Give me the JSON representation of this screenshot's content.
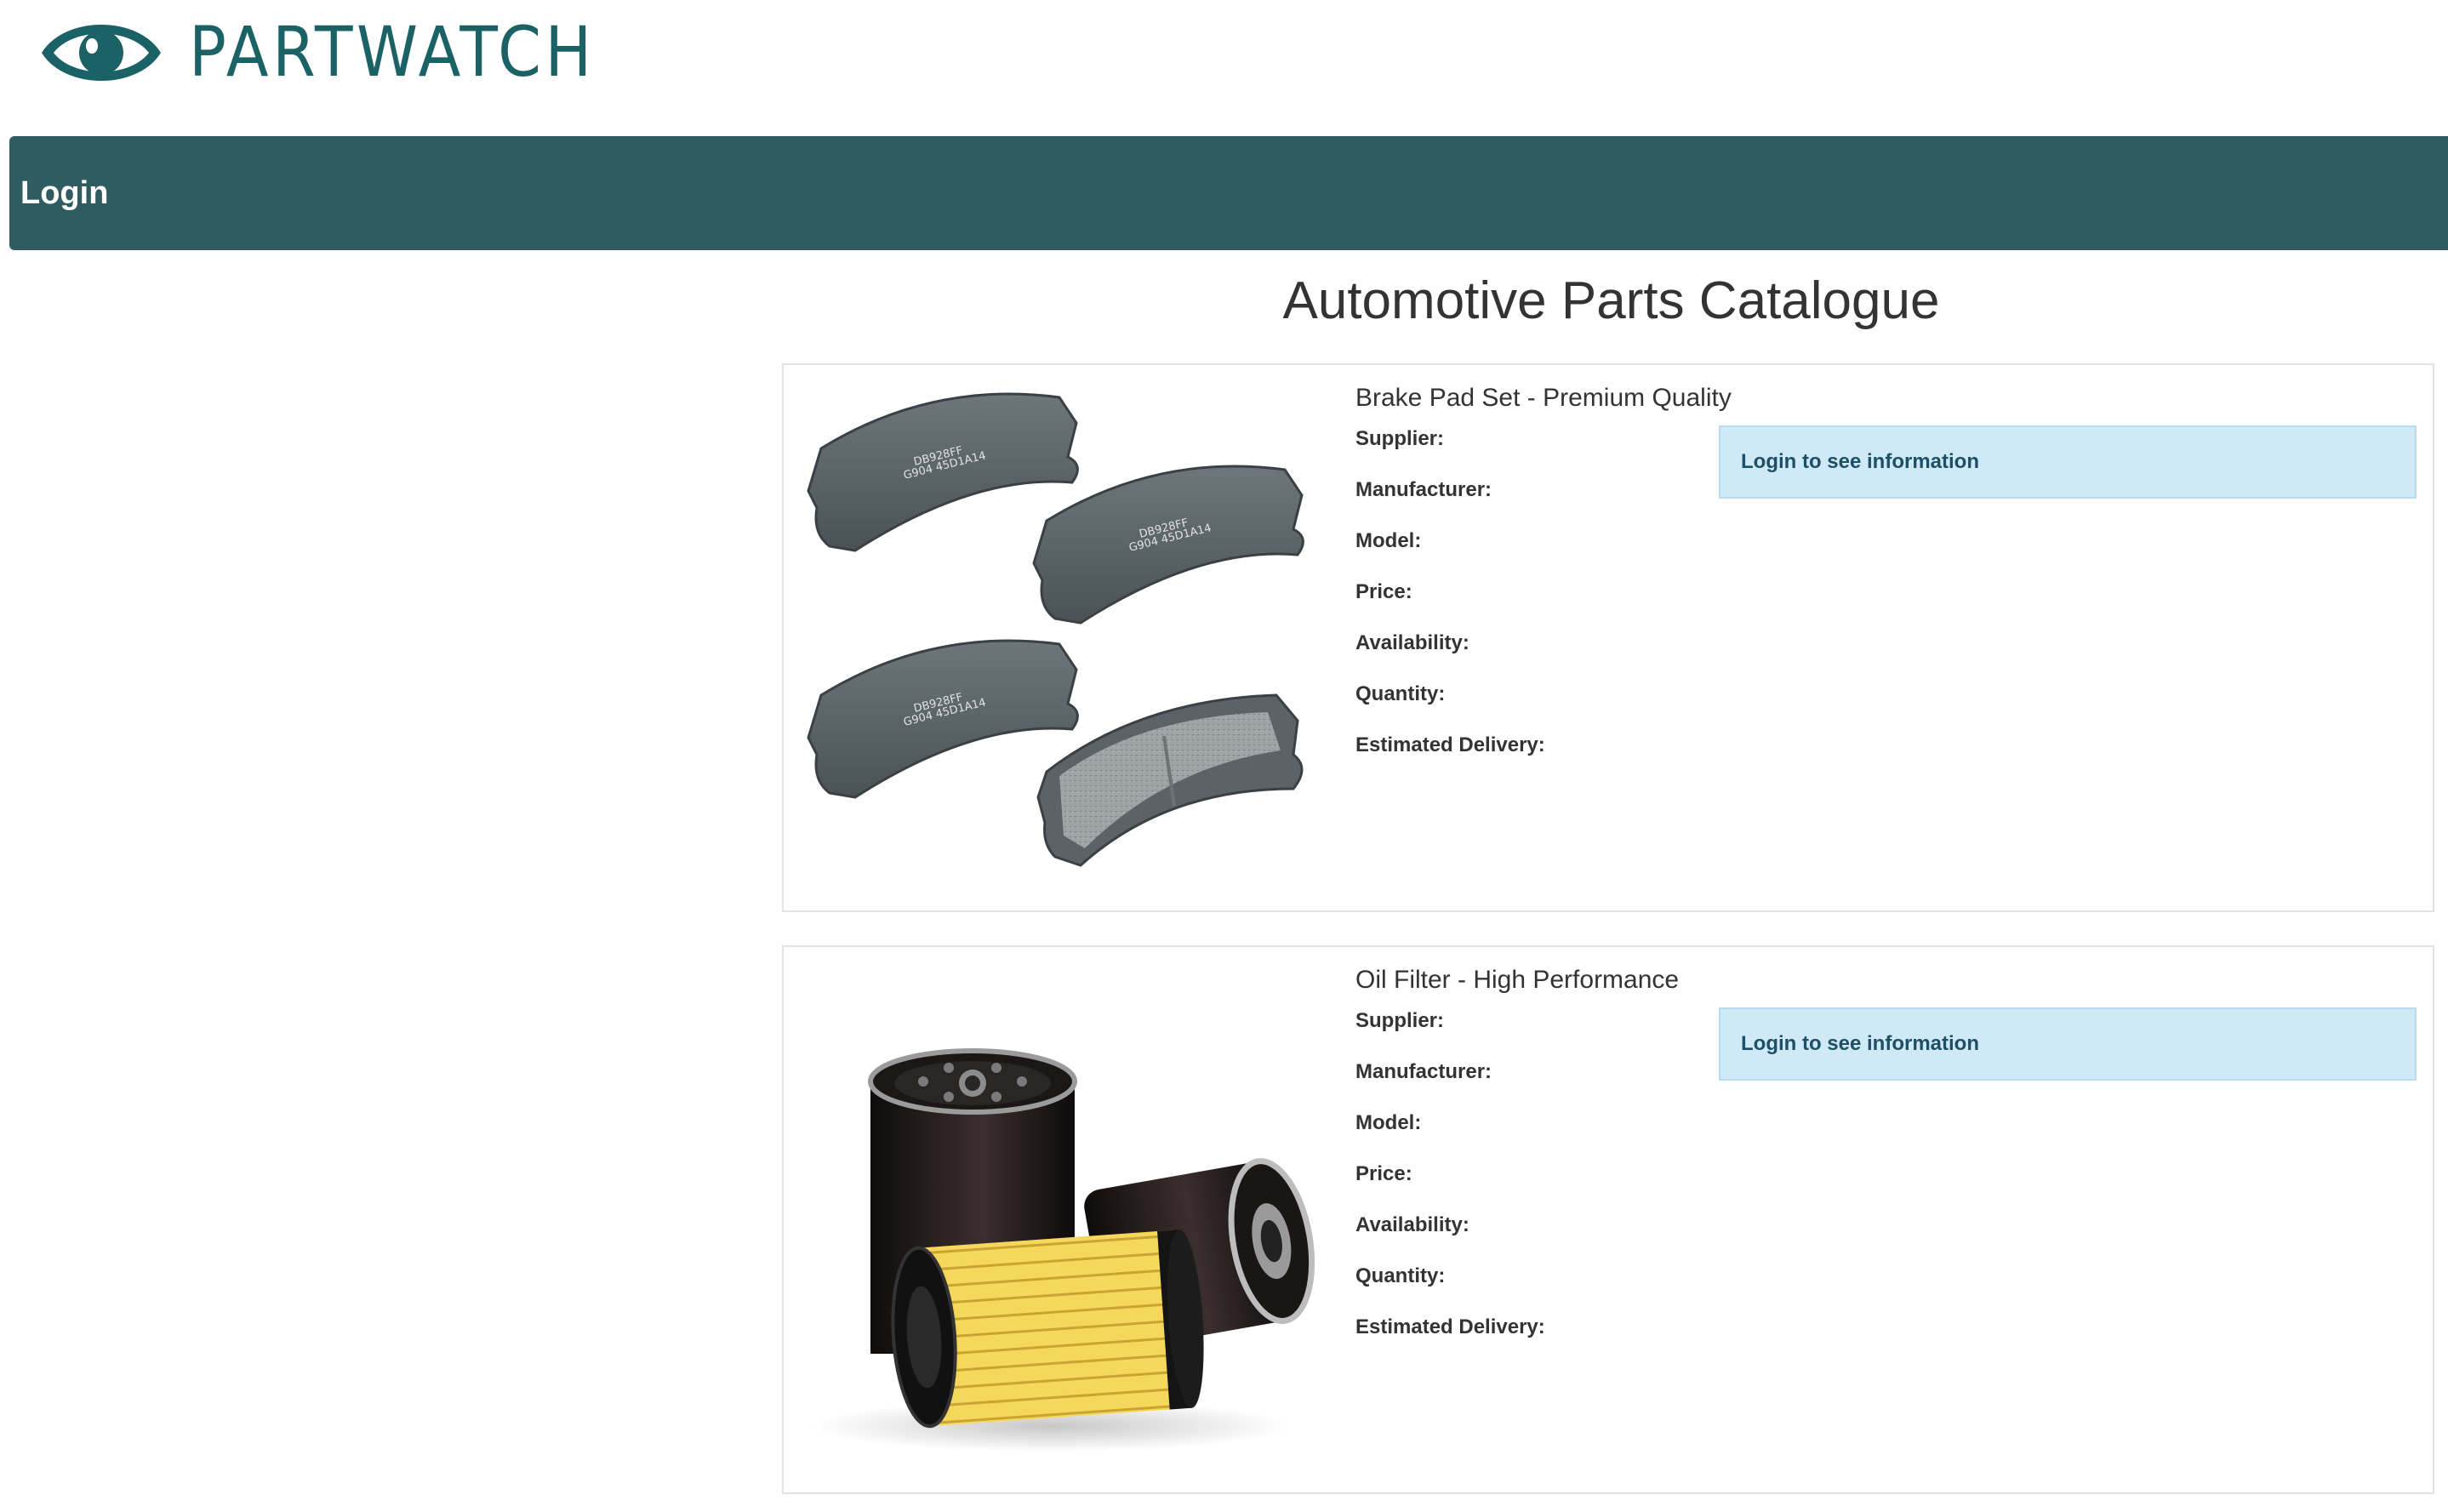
{
  "brand": {
    "name": "PARTWATCH",
    "logo_icon": "eye-icon",
    "color": "#1b6267"
  },
  "navbar": {
    "login_label": "Login",
    "color": "#305c60"
  },
  "page": {
    "title": "Automotive Parts Catalogue"
  },
  "field_labels": {
    "supplier": "Supplier:",
    "manufacturer": "Manufacturer:",
    "model": "Model:",
    "price": "Price:",
    "availability": "Availability:",
    "quantity": "Quantity:",
    "estimated_delivery": "Estimated Delivery:"
  },
  "products": [
    {
      "name": "Brake Pad Set - Premium Quality",
      "image": "brake-pads-image",
      "pad_codes": [
        "DB928FF",
        "G904 45D1A14"
      ],
      "notice": "Login to see information"
    },
    {
      "name": "Oil Filter - High Performance",
      "image": "oil-filters-image",
      "notice": "Login to see information"
    }
  ],
  "colors": {
    "notice_bg": "#cfe9f6",
    "notice_text": "#1d4f66"
  }
}
